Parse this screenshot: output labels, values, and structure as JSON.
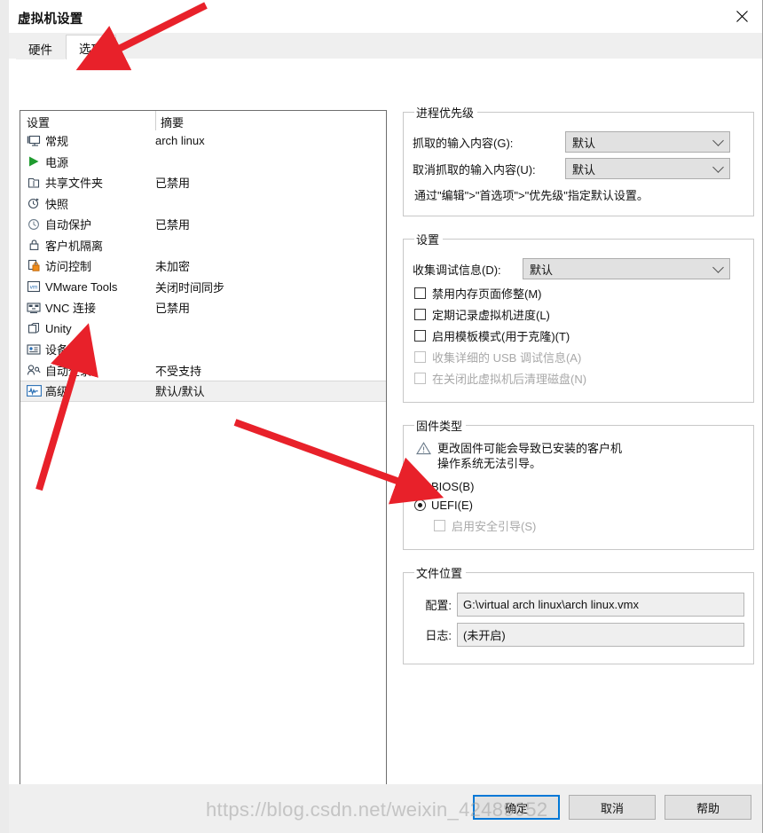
{
  "window": {
    "title": "虚拟机设置",
    "close_icon": "close-icon"
  },
  "tabs": [
    {
      "label": "硬件",
      "active": false
    },
    {
      "label": "选项",
      "active": true
    }
  ],
  "list": {
    "header": {
      "col1": "设置",
      "col2": "摘要"
    },
    "rows": [
      {
        "icon": "monitor-icon",
        "label": "常规",
        "summary": "arch linux",
        "selected": false
      },
      {
        "icon": "power-play-icon",
        "label": "电源",
        "summary": "",
        "selected": false
      },
      {
        "icon": "folder-share-icon",
        "label": "共享文件夹",
        "summary": "已禁用",
        "selected": false
      },
      {
        "icon": "snapshot-icon",
        "label": "快照",
        "summary": "",
        "selected": false
      },
      {
        "icon": "autoprotect-icon",
        "label": "自动保护",
        "summary": "已禁用",
        "selected": false
      },
      {
        "icon": "lock-icon",
        "label": "客户机隔离",
        "summary": "",
        "selected": false
      },
      {
        "icon": "access-lock-icon",
        "label": "访问控制",
        "summary": "未加密",
        "selected": false
      },
      {
        "icon": "vm-tools-icon",
        "label": "VMware Tools",
        "summary": "关闭时间同步",
        "selected": false
      },
      {
        "icon": "vnc-icon",
        "label": "VNC 连接",
        "summary": "已禁用",
        "selected": false
      },
      {
        "icon": "unity-icon",
        "label": "Unity",
        "summary": "",
        "selected": false
      },
      {
        "icon": "deviceview-icon",
        "label": "设备视图",
        "summary": "",
        "selected": false
      },
      {
        "icon": "autologon-icon",
        "label": "自动登录",
        "summary": "不受支持",
        "selected": false
      },
      {
        "icon": "advanced-icon",
        "label": "高级",
        "summary": "默认/默认",
        "selected": true
      }
    ]
  },
  "process_priority": {
    "legend": "进程优先级",
    "grabbed_label": "抓取的输入内容(G):",
    "grabbed_value": "默认",
    "ungrabbed_label": "取消抓取的输入内容(U):",
    "ungrabbed_value": "默认",
    "hint": "通过\"编辑\">\"首选项\">\"优先级\"指定默认设置。"
  },
  "settings": {
    "legend": "设置",
    "debug_label": "收集调试信息(D):",
    "debug_value": "默认",
    "checkboxes": [
      {
        "label": "禁用内存页面修整(M)",
        "checked": false,
        "disabled": false
      },
      {
        "label": "定期记录虚拟机进度(L)",
        "checked": false,
        "disabled": false
      },
      {
        "label": "启用模板模式(用于克隆)(T)",
        "checked": false,
        "disabled": false
      },
      {
        "label": "收集详细的 USB 调试信息(A)",
        "checked": false,
        "disabled": true
      },
      {
        "label": "在关闭此虚拟机后清理磁盘(N)",
        "checked": false,
        "disabled": true
      }
    ]
  },
  "firmware": {
    "legend": "固件类型",
    "warning_icon": "warning-triangle-icon",
    "warning_line1": "更改固件可能会导致已安装的客户机",
    "warning_line2": "操作系统无法引导。",
    "options": [
      {
        "label": "BIOS(B)",
        "selected": false
      },
      {
        "label": "UEFI(E)",
        "selected": true
      }
    ],
    "secure_boot": {
      "label": "启用安全引导(S)",
      "checked": false,
      "disabled": true
    }
  },
  "file_location": {
    "legend": "文件位置",
    "config_label": "配置:",
    "config_value": "G:\\virtual arch linux\\arch linux.vmx",
    "log_label": "日志:",
    "log_value": "(未开启)"
  },
  "buttons": {
    "ok": "确定",
    "cancel": "取消",
    "help": "帮助"
  },
  "watermark": {
    "text": "https://blog.csdn.net/weixin_42489052"
  },
  "colors": {
    "accent": "#0078d7",
    "annotation_red": "#e8212a",
    "window_bg": "#ffffff",
    "panel_bg": "#efefef",
    "selected_row": "#f0f0f0"
  },
  "annotations": [
    {
      "name": "arrow-to-options-tab",
      "target": "选项 tab"
    },
    {
      "name": "arrow-to-advanced-row",
      "target": "高级 list row"
    },
    {
      "name": "arrow-to-uefi-radio",
      "target": "UEFI(E) radio"
    }
  ]
}
